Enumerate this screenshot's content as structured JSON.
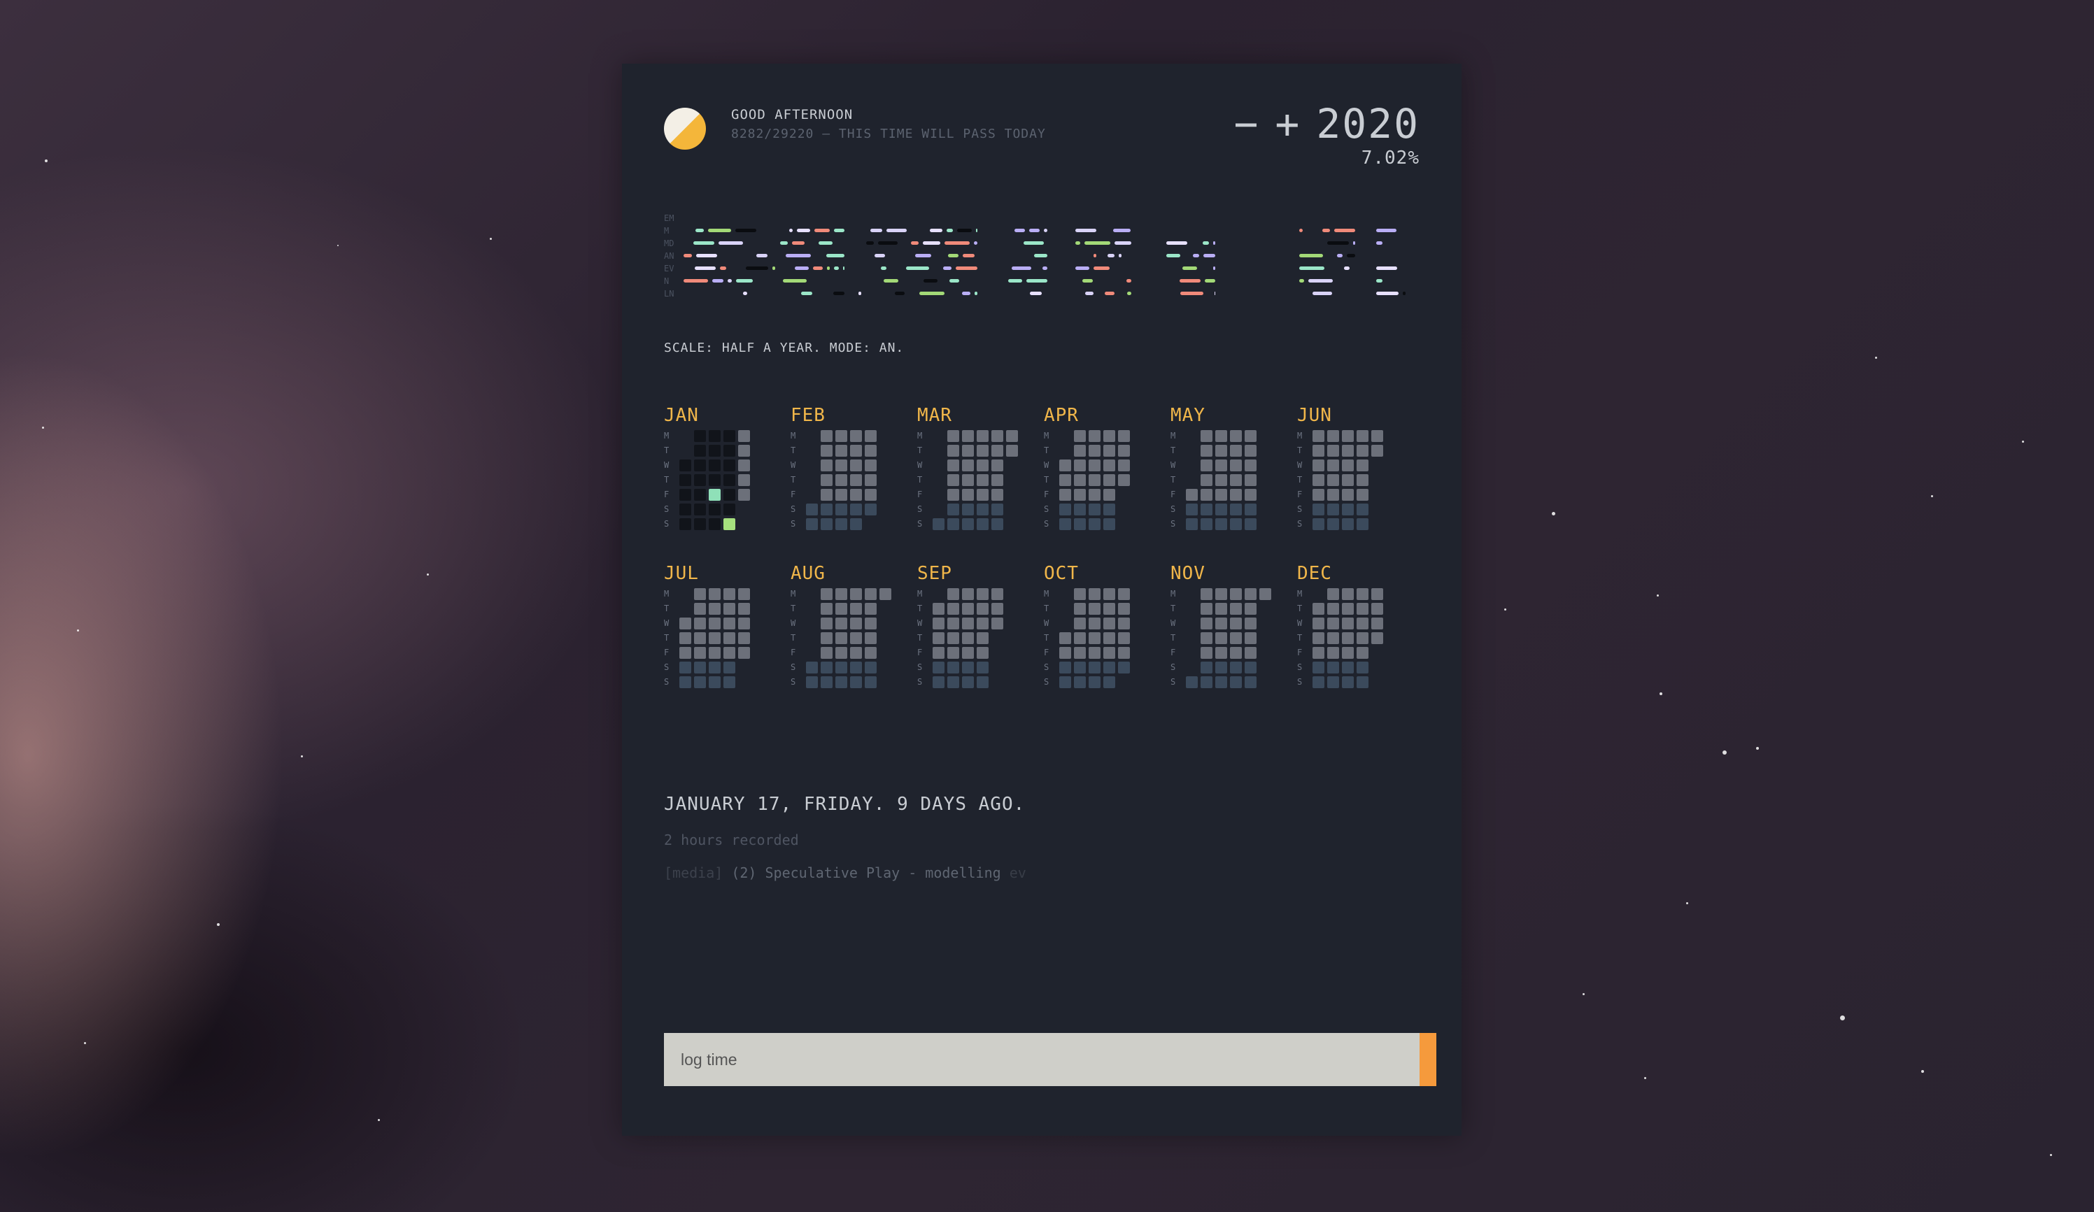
{
  "header": {
    "greeting": "GOOD AFTERNOON",
    "subtitle": "8282/29220 — THIS TIME WILL PASS TODAY",
    "minus": "−",
    "plus": "+",
    "year": "2020",
    "percent": "7.02%"
  },
  "timeline": {
    "row_labels": [
      "EM",
      "M",
      "MD",
      "AN",
      "EV",
      "N",
      "LN"
    ]
  },
  "scale_text": "SCALE: HALF A YEAR. MODE: AN.",
  "months": [
    {
      "name": "JAN"
    },
    {
      "name": "FEB"
    },
    {
      "name": "MAR"
    },
    {
      "name": "APR"
    },
    {
      "name": "MAY"
    },
    {
      "name": "JUN"
    },
    {
      "name": "JUL"
    },
    {
      "name": "AUG"
    },
    {
      "name": "SEP"
    },
    {
      "name": "OCT"
    },
    {
      "name": "NOV"
    },
    {
      "name": "DEC"
    }
  ],
  "weekday_labels": [
    "M",
    "T",
    "W",
    "T",
    "F",
    "S",
    "S"
  ],
  "selected_day": {
    "title": "JANUARY 17, FRIDAY. 9 DAYS AGO.",
    "hours": "2 hours recorded",
    "entry_tag": "[media]",
    "entry_text": "(2) Speculative Play - modelling",
    "entry_mode": "ev"
  },
  "log": {
    "placeholder": "log time"
  },
  "colors": {
    "accent": "#f0b64a",
    "panel": "#1f232d",
    "future_day": "#6c707a",
    "weekend_day": "#3b4a5c",
    "past_day": "#11141a",
    "log_bar": "#f59a3c"
  }
}
